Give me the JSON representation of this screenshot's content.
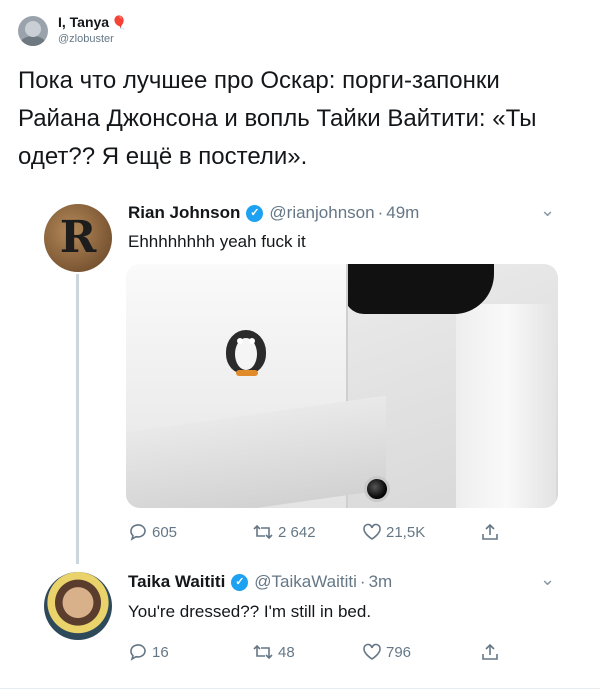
{
  "top": {
    "name": "I, Tanya",
    "balloon": "🎈",
    "handle": "@zlobuster",
    "text": "Пока что лучшее про Оскар: порги-запонки Райана Джонсона и вопль Тайки Вайтити: «Ты одет?? Я ещё в постели»."
  },
  "tweet1": {
    "avatar_letter": "R",
    "name": "Rian Johnson",
    "handle": "@rianjohnson",
    "dot": "·",
    "time": "49m",
    "text": "Ehhhhhhhh yeah fuck it",
    "replies": "605",
    "retweets": "2 642",
    "likes": "21,5K"
  },
  "tweet2": {
    "name": "Taika Waititi",
    "handle": "@TaikaWaititi",
    "dot": "·",
    "time": "3m",
    "text": "You're dressed?? I'm still in bed.",
    "replies": "16",
    "retweets": "48",
    "likes": "796"
  },
  "icons": {
    "verified": "verified-badge-icon",
    "reply": "reply-icon",
    "retweet": "retweet-icon",
    "like": "heart-icon",
    "share": "share-icon",
    "chevron": "chevron-down-icon"
  },
  "colors": {
    "accent": "#1da1f2",
    "text": "#14171a",
    "muted": "#657786"
  }
}
